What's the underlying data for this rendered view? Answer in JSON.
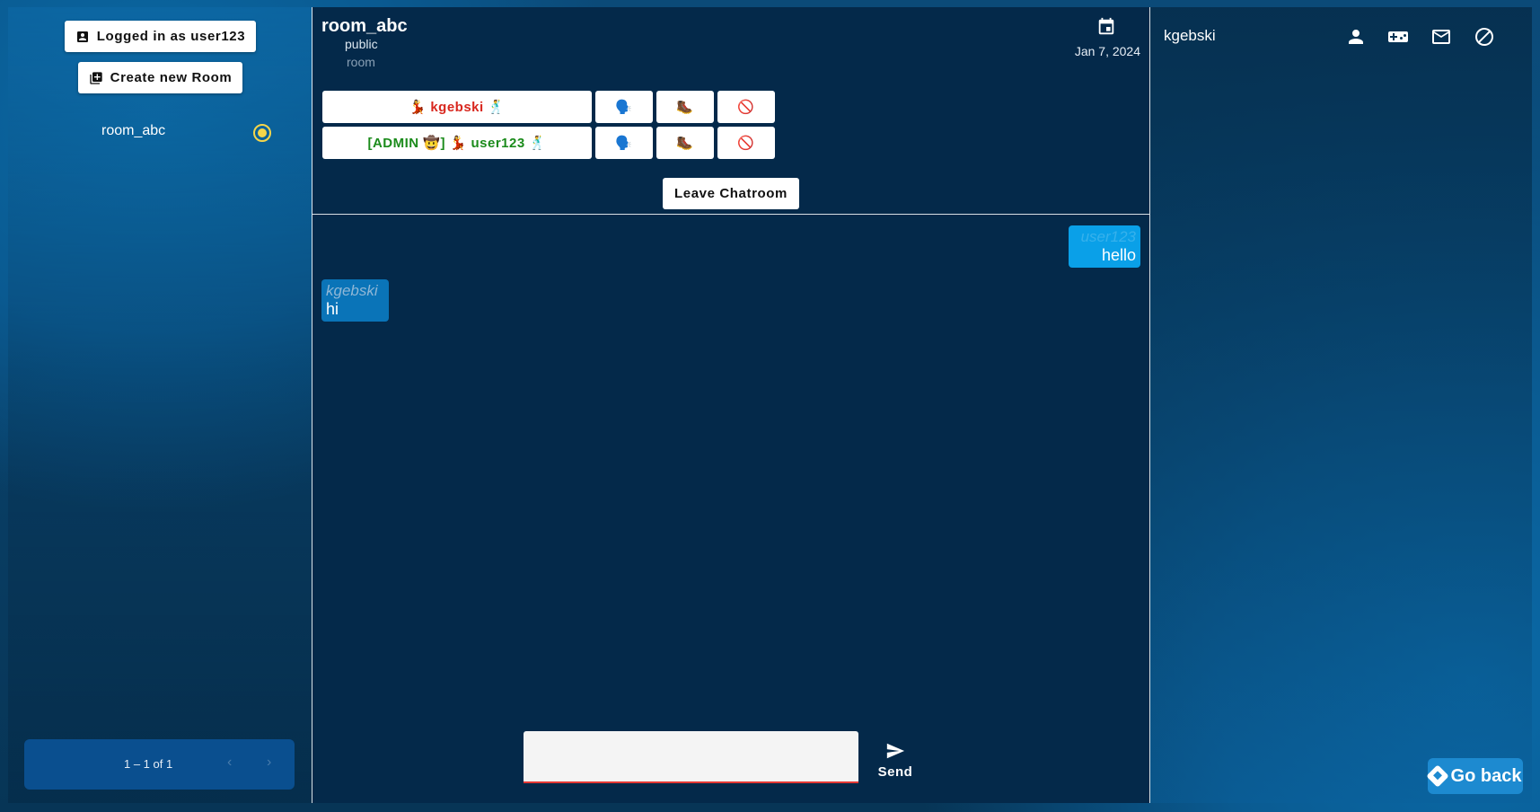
{
  "sidebar": {
    "login_label": "Logged in as user123",
    "create_room_label": "Create new Room",
    "rooms": [
      {
        "name": "room_abc",
        "selected": true
      }
    ],
    "paginator": {
      "range": "1 – 1 of 1",
      "prev": "‹",
      "next": "›"
    }
  },
  "room": {
    "title": "room_abc",
    "visibility": "public",
    "type": "room",
    "date": "Jan 7, 2024",
    "members": [
      {
        "label": "💃 kgebski 🕺",
        "color": "#d8261d",
        "actions": [
          "🗣️",
          "🥾",
          "🚫"
        ]
      },
      {
        "label": "[ADMIN 🤠] 💃 user123 🕺",
        "color": "#1b8b1b",
        "actions": [
          "🗣️",
          "🥾",
          "🚫"
        ]
      }
    ],
    "leave_label": "Leave Chatroom"
  },
  "messages": [
    {
      "author": "user123",
      "text": "hello",
      "outgoing": true
    },
    {
      "author": "kgebski",
      "text": "hi",
      "outgoing": false
    }
  ],
  "composer": {
    "value": "",
    "send_label": "Send"
  },
  "right_panel": {
    "peer_name": "kgebski",
    "icons": [
      "person-icon",
      "gamepad-icon",
      "mail-icon",
      "block-icon"
    ]
  },
  "go_back_label": "Go back",
  "colors": {
    "accent": "#0aa0e8",
    "indicator": "#f5d64a",
    "panel_bg": "#04294a"
  }
}
